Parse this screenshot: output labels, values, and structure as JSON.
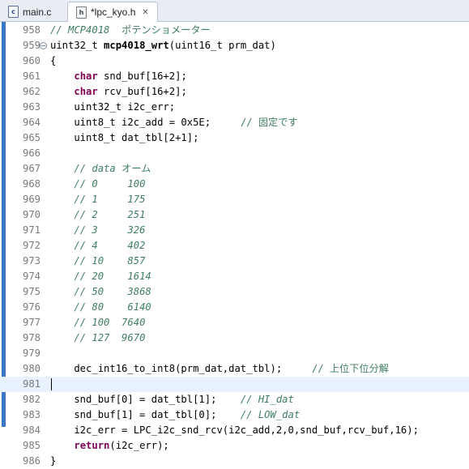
{
  "tabs": [
    {
      "label": "main.c",
      "icon": "c-source-file-icon"
    },
    {
      "label": "*lpc_kyo.h",
      "icon": "header-file-icon"
    }
  ],
  "colors": {
    "keyword": "#7f0055",
    "comment": "#3f7f5f",
    "line_number": "#7a7a7a",
    "current_line": "#e8f2fe",
    "ruler": "#3a77c6"
  },
  "lines": [
    {
      "n": "958",
      "tokens": [
        [
          "cmi",
          "// MCP4018  "
        ],
        [
          "cm",
          "ポテンショメーター"
        ]
      ]
    },
    {
      "n": "959",
      "fold": "⊖",
      "tokens": [
        [
          "",
          "uint32_t "
        ],
        [
          "fn",
          "mcp4018_wrt"
        ],
        [
          "",
          "(uint16_t prm_dat)"
        ]
      ]
    },
    {
      "n": "960",
      "tokens": [
        [
          "",
          "{"
        ]
      ]
    },
    {
      "n": "961",
      "tokens": [
        [
          "",
          "    "
        ],
        [
          "kw",
          "char"
        ],
        [
          "",
          " snd_buf[16+2];"
        ]
      ]
    },
    {
      "n": "962",
      "tokens": [
        [
          "",
          "    "
        ],
        [
          "kw",
          "char"
        ],
        [
          "",
          " rcv_buf[16+2];"
        ]
      ]
    },
    {
      "n": "963",
      "tokens": [
        [
          "",
          "    uint32_t i2c_err;"
        ]
      ]
    },
    {
      "n": "964",
      "tokens": [
        [
          "",
          "    uint8_t i2c_add = 0x5E;     "
        ],
        [
          "cm",
          "// 固定です"
        ]
      ]
    },
    {
      "n": "965",
      "tokens": [
        [
          "",
          "    uint8_t dat_tbl[2+1];"
        ]
      ]
    },
    {
      "n": "966",
      "tokens": []
    },
    {
      "n": "967",
      "tokens": [
        [
          "",
          "    "
        ],
        [
          "cmi",
          "// data "
        ],
        [
          "cm",
          "オーム"
        ]
      ]
    },
    {
      "n": "968",
      "tokens": [
        [
          "",
          "    "
        ],
        [
          "cmi",
          "// 0     100"
        ]
      ]
    },
    {
      "n": "969",
      "tokens": [
        [
          "",
          "    "
        ],
        [
          "cmi",
          "// 1     175"
        ]
      ]
    },
    {
      "n": "970",
      "tokens": [
        [
          "",
          "    "
        ],
        [
          "cmi",
          "// 2     251"
        ]
      ]
    },
    {
      "n": "971",
      "tokens": [
        [
          "",
          "    "
        ],
        [
          "cmi",
          "// 3     326"
        ]
      ]
    },
    {
      "n": "972",
      "tokens": [
        [
          "",
          "    "
        ],
        [
          "cmi",
          "// 4     402"
        ]
      ]
    },
    {
      "n": "973",
      "tokens": [
        [
          "",
          "    "
        ],
        [
          "cmi",
          "// 10    857"
        ]
      ]
    },
    {
      "n": "974",
      "tokens": [
        [
          "",
          "    "
        ],
        [
          "cmi",
          "// 20    1614"
        ]
      ]
    },
    {
      "n": "975",
      "tokens": [
        [
          "",
          "    "
        ],
        [
          "cmi",
          "// 50    3868"
        ]
      ]
    },
    {
      "n": "976",
      "tokens": [
        [
          "",
          "    "
        ],
        [
          "cmi",
          "// 80    6140"
        ]
      ]
    },
    {
      "n": "977",
      "tokens": [
        [
          "",
          "    "
        ],
        [
          "cmi",
          "// 100  7640"
        ]
      ]
    },
    {
      "n": "978",
      "tokens": [
        [
          "",
          "    "
        ],
        [
          "cmi",
          "// 127  9670"
        ]
      ]
    },
    {
      "n": "979",
      "tokens": []
    },
    {
      "n": "980",
      "tokens": [
        [
          "",
          "    dec_int16_to_int8(prm_dat,dat_tbl);     "
        ],
        [
          "cm",
          "// 上位下位分解"
        ]
      ]
    },
    {
      "n": "981",
      "tokens": [],
      "current": true
    },
    {
      "n": "982",
      "tokens": [
        [
          "",
          "    snd_buf[0] = dat_tbl[1];    "
        ],
        [
          "cmi",
          "// HI_dat"
        ]
      ]
    },
    {
      "n": "983",
      "tokens": [
        [
          "",
          "    snd_buf[1] = dat_tbl[0];    "
        ],
        [
          "cmi",
          "// LOW_dat"
        ]
      ]
    },
    {
      "n": "984",
      "tokens": [
        [
          "",
          "    i2c_err = LPC_i2c_snd_rcv(i2c_add,2,0,snd_buf,rcv_buf,16);"
        ]
      ]
    },
    {
      "n": "985",
      "tokens": [
        [
          "",
          "    "
        ],
        [
          "kw",
          "return"
        ],
        [
          "",
          "(i2c_err);"
        ]
      ]
    },
    {
      "n": "986",
      "tokens": [
        [
          "",
          "}"
        ]
      ]
    }
  ]
}
